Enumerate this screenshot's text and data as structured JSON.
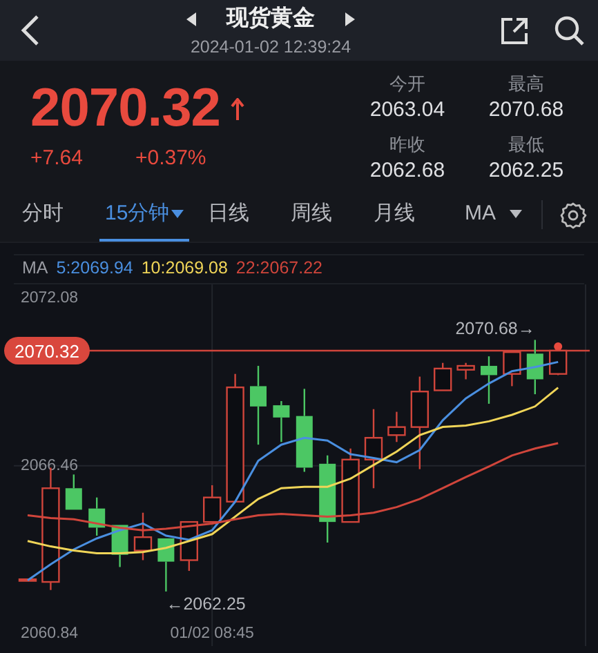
{
  "header": {
    "title": "现货黄金",
    "timestamp": "2024-01-02 12:39:24"
  },
  "quote": {
    "price": "2070.32",
    "rising": true,
    "change": "+7.64",
    "change_percent": "+0.37%",
    "stats": [
      {
        "label": "今开",
        "value": "2063.04"
      },
      {
        "label": "最高",
        "value": "2070.68"
      },
      {
        "label": "昨收",
        "value": "2062.68"
      },
      {
        "label": "最低",
        "value": "2062.25"
      }
    ]
  },
  "tabs": [
    {
      "label": "分时",
      "selected": false,
      "dropdown": false
    },
    {
      "label": "15分钟",
      "selected": true,
      "dropdown": true
    },
    {
      "label": "日线",
      "selected": false,
      "dropdown": false
    },
    {
      "label": "周线",
      "selected": false,
      "dropdown": false
    },
    {
      "label": "月线",
      "selected": false,
      "dropdown": false
    },
    {
      "label": "MA",
      "selected": false,
      "dropdown": true
    }
  ],
  "chart": {
    "legend_title": "MA",
    "time_label": "01/02 08:45",
    "chart_data": {
      "type": "candlestick",
      "ylim": [
        2060.42,
        2072.54
      ],
      "yticks": [
        {
          "value": 2072.08,
          "label": "2072.08"
        },
        {
          "value": 2066.46,
          "label": "2066.46"
        },
        {
          "value": 2060.84,
          "label": "2060.84"
        }
      ],
      "ohlc": [
        [
          2062.62,
          2062.66,
          2062.62,
          2062.66
        ],
        [
          2062.57,
          2066.4,
          2062.3,
          2065.71
        ],
        [
          2065.71,
          2066.17,
          2064.99,
          2064.99
        ],
        [
          2065.03,
          2065.4,
          2064.12,
          2064.39
        ],
        [
          2064.48,
          2064.48,
          2063.07,
          2063.48
        ],
        [
          2063.62,
          2064.89,
          2063.3,
          2064.07
        ],
        [
          2064.03,
          2064.03,
          2062.25,
          2063.25
        ],
        [
          2063.3,
          2064.58,
          2062.94,
          2064.58
        ],
        [
          2064.58,
          2065.81,
          2064.58,
          2065.4
        ],
        [
          2065.26,
          2069.54,
          2065.26,
          2069.09
        ],
        [
          2069.13,
          2069.81,
          2067.17,
          2068.45
        ],
        [
          2068.49,
          2068.63,
          2067.26,
          2068.08
        ],
        [
          2068.13,
          2069.04,
          2066.26,
          2066.4
        ],
        [
          2066.53,
          2066.81,
          2063.89,
          2064.58
        ],
        [
          2064.58,
          2067.04,
          2064.58,
          2066.67
        ],
        [
          2066.67,
          2068.36,
          2065.71,
          2067.4
        ],
        [
          2067.49,
          2068.27,
          2067.26,
          2067.76
        ],
        [
          2067.76,
          2069.45,
          2066.35,
          2068.95
        ],
        [
          2068.99,
          2069.91,
          2068.99,
          2069.72
        ],
        [
          2069.68,
          2069.91,
          2069.36,
          2069.81
        ],
        [
          2069.81,
          2070.13,
          2068.54,
          2069.5
        ],
        [
          2069.54,
          2070.27,
          2069.13,
          2070.27
        ],
        [
          2070.22,
          2070.68,
          2068.86,
          2069.36
        ],
        [
          2069.54,
          2070.32,
          2069.5,
          2070.32
        ]
      ],
      "series": [
        {
          "name": "5:2069.94",
          "type": "line",
          "color": "#4a8fe0",
          "values": [
            2062.62,
            2063.16,
            2063.66,
            2064.03,
            2064.3,
            2064.53,
            2064.12,
            2063.98,
            2064.3,
            2065.26,
            2066.63,
            2067.17,
            2067.4,
            2067.31,
            2066.85,
            2066.72,
            2066.58,
            2066.99,
            2067.99,
            2068.72,
            2069.22,
            2069.63,
            2069.77,
            2069.94
          ]
        },
        {
          "name": "10:2069.08",
          "type": "line",
          "color": "#f0d558",
          "values": [
            2063.94,
            2063.76,
            2063.62,
            2063.53,
            2063.53,
            2063.57,
            2063.71,
            2063.94,
            2064.17,
            2064.76,
            2065.35,
            2065.71,
            2065.76,
            2065.76,
            2066.03,
            2066.49,
            2066.94,
            2067.49,
            2067.76,
            2067.81,
            2067.95,
            2068.17,
            2068.45,
            2069.08
          ]
        },
        {
          "name": "22:2067.22",
          "type": "line",
          "color": "#d0453b",
          "values": [
            2064.8,
            2064.71,
            2064.67,
            2064.53,
            2064.39,
            2064.3,
            2064.35,
            2064.44,
            2064.53,
            2064.67,
            2064.8,
            2064.85,
            2064.8,
            2064.76,
            2064.8,
            2064.89,
            2065.08,
            2065.35,
            2065.71,
            2066.08,
            2066.44,
            2066.81,
            2067.04,
            2067.22
          ]
        }
      ],
      "ref_lines": [
        {
          "axis": "y",
          "value": 2070.32,
          "label": "2070.32"
        }
      ],
      "annotations": [
        "2070.68→",
        "←2062.25"
      ]
    }
  }
}
